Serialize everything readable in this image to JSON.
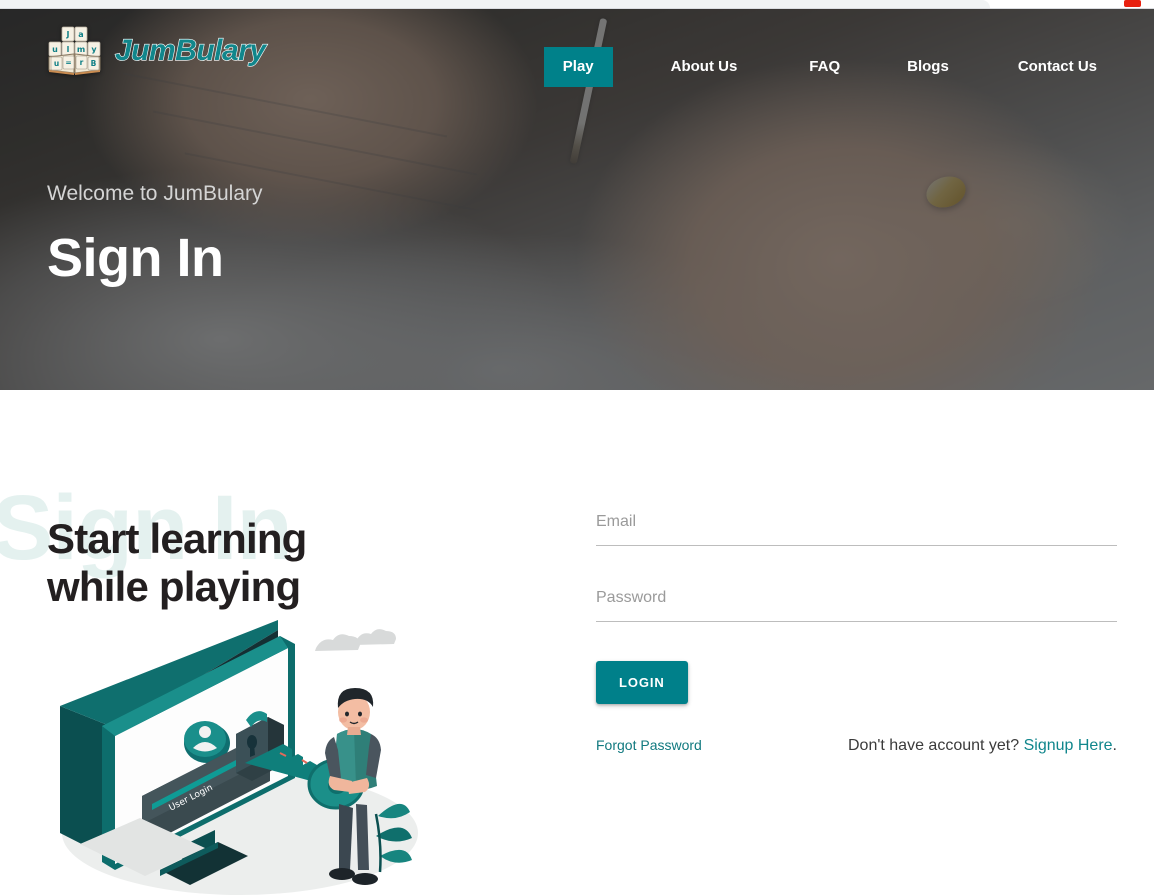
{
  "browser": {
    "badge_label": ""
  },
  "header": {
    "brand_name": "JumBulary",
    "logo_icon": "book-letter-tiles-logo",
    "logo_tiles": [
      "J",
      "a",
      "u",
      "l",
      "m",
      "y",
      "u",
      "=",
      "r",
      "B"
    ],
    "nav": [
      {
        "label": "Play",
        "active": true
      },
      {
        "label": "About Us",
        "active": false
      },
      {
        "label": "FAQ",
        "active": false
      },
      {
        "label": "Blogs",
        "active": false
      },
      {
        "label": "Contact Us",
        "active": false
      }
    ]
  },
  "hero": {
    "eyebrow": "Welcome to JumBulary",
    "title": "Sign In",
    "background_image": "hands-signing-document-photo"
  },
  "main": {
    "watermark_text": "Sign In",
    "promo_heading_line1": "Start learning",
    "promo_heading_line2": "while playing",
    "illustration": {
      "name": "user-login-monitor-key-illustration",
      "screen_label": "User Login",
      "elements": [
        "monitor",
        "avatar-icon",
        "padlock-icon",
        "key",
        "person",
        "clouds",
        "plant"
      ]
    }
  },
  "form": {
    "email": {
      "label": "Email",
      "placeholder": "Email",
      "value": ""
    },
    "password": {
      "label": "Password",
      "placeholder": "Password",
      "value": ""
    },
    "login_button_label": "LOGIN",
    "forgot_password_label": "Forgot Password",
    "signup_prompt_text": "Don't have account yet? ",
    "signup_link_label": "Signup Here",
    "signup_suffix": "."
  },
  "colors": {
    "accent_teal": "#00808a",
    "nav_active_teal": "#00818a",
    "brand_teal": "#11868b",
    "link_teal": "#10868c",
    "watermark_mint": "#e4f1ef",
    "hero_overlay": "#262a2c",
    "heading_dark": "#231f20",
    "badge_red": "#e8200f"
  }
}
